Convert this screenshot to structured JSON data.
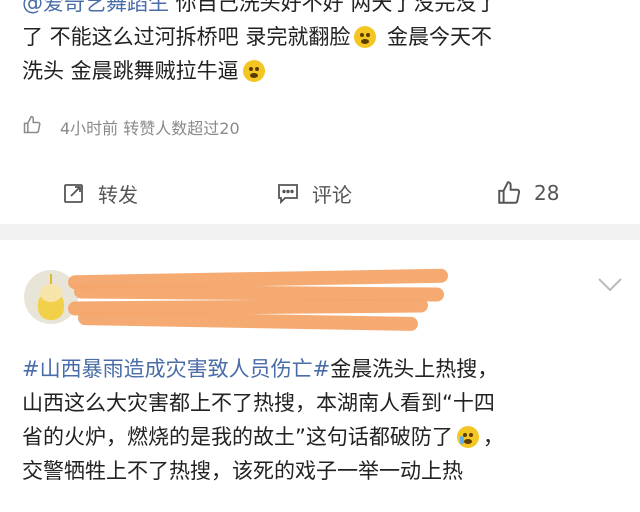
{
  "post1": {
    "mention": "@爱奇艺舞蹈生",
    "text_line1_rest": " 你自己洗头好不好 两天了没完没了",
    "text_line2": "了 不能这么过河拆桥吧 录完就翻脸",
    "text_line2_b": " 金晨今天不",
    "text_line3": "洗头 金晨跳舞贼拉牛逼",
    "meta": "4小时前 转赞人数超过20",
    "actions": {
      "repost": "转发",
      "comment": "评论",
      "like_count": "28"
    }
  },
  "post2": {
    "hashtag": "#山西暴雨造成灾害致人员伤亡#",
    "text_line1_rest": "金晨洗头上热搜，",
    "text_line2": "山西这么大灾害都上不了热搜，本湖南人看到“十四",
    "text_line3": "省的火炉，燃烧的是我的故土”这句话都破防了",
    "text_line4": "交警牺牲上不了热搜，该死的戏子一举一动上热"
  },
  "colors": {
    "link": "#4a6da8",
    "divider": "#f2f2f2",
    "redaction": "#f4a56a"
  }
}
